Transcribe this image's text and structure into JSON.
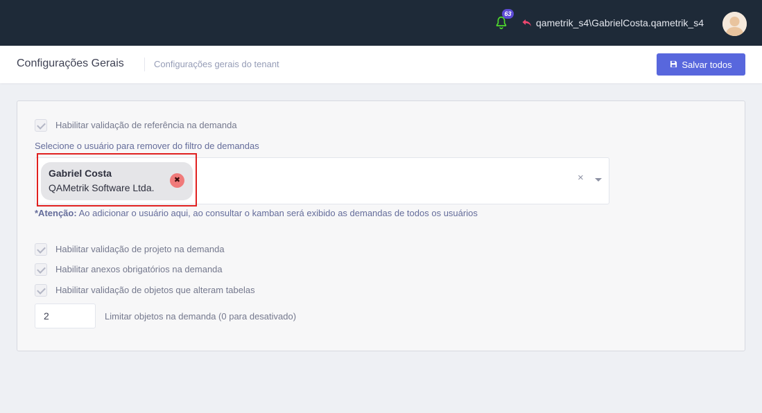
{
  "header": {
    "notification_count": "63",
    "user_name": "qametrik_s4\\GabrielCosta.qametrik_s4",
    "icons": [
      "bell-icon",
      "switch-account-icon",
      "avatar"
    ]
  },
  "subheader": {
    "title": "Configurações Gerais",
    "description": "Configurações gerais do tenant",
    "save_label": "Salvar todos"
  },
  "settings": {
    "reference_validation_label": "Habilitar validação de referência na demanda",
    "select_label": "Selecione o usuário para remover do filtro de demandas",
    "selected_user": {
      "name": "Gabriel Costa",
      "company": "QAMetrik Software Ltda."
    },
    "attention_prefix": "*Atenção:",
    "attention_text": " Ao adicionar o usuário aqui, ao consultar o kamban será exibido as demandas de todos os usuários",
    "project_validation_label": "Habilitar validação de projeto na demanda",
    "required_attachments_label": "Habilitar anexos obrigatórios na demanda",
    "objects_validation_label": "Habilitar validação de objetos que alteram tabelas",
    "limit_value": "2",
    "limit_label": "Limitar objetos na demanda (0 para desativado)"
  },
  "colors": {
    "topbar": "#1e2a38",
    "accent": "#5867dd",
    "badge": "#5d4bd6",
    "highlight": "#e0201f",
    "bell": "#34bfa3"
  }
}
